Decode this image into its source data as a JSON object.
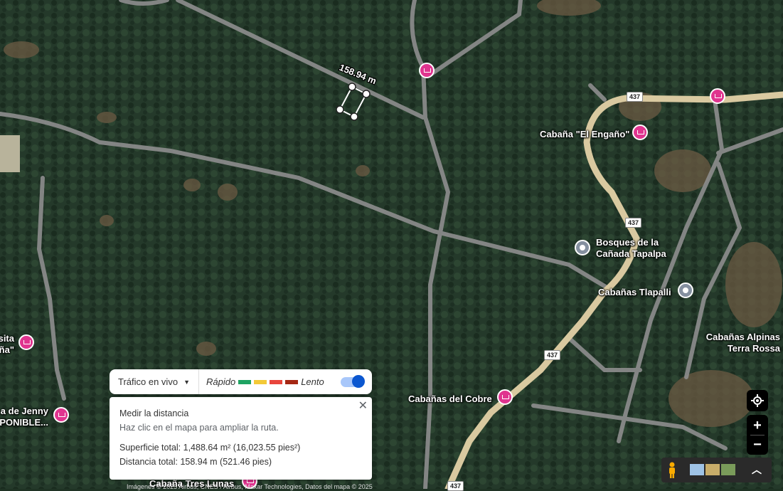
{
  "map": {
    "measure_label": "158.94 m",
    "route_shields": [
      "437",
      "437",
      "437",
      "437"
    ],
    "places": [
      {
        "name": "Cabaña \"El Engaño\"",
        "pin": "hotel-pin-icon"
      },
      {
        "name": "Bosques de la\nCañada Tapalpa",
        "pin": "place-pin-icon"
      },
      {
        "name": "Cabañas Tlapalli",
        "pin": "place-pin-icon"
      },
      {
        "name": "Cabañas Alpinas\nTerra Rossa",
        "pin": null
      },
      {
        "name": "Cabañas del Cobre",
        "pin": "hotel-pin-icon"
      },
      {
        "name": "sita\nña\"",
        "pin": "hotel-pin-icon"
      },
      {
        "name": "a de Jenny\nPONIBLE...",
        "pin": "hotel-pin-icon"
      },
      {
        "name": "Cabaña Tres Lunas",
        "pin": "hotel-pin-icon"
      }
    ]
  },
  "traffic": {
    "selector_label": "Tráfico en vivo",
    "fast_label": "Rápido",
    "slow_label": "Lento",
    "colors": [
      "#1ea362",
      "#f3c937",
      "#e8453c",
      "#a52714"
    ],
    "enabled": true
  },
  "measure_panel": {
    "title": "Medir la distancia",
    "hint": "Haz clic en el mapa para ampliar la ruta.",
    "area": "Superficie total: 1,488.64 m² (16,023.55 pies²)",
    "distance": "Distancia total: 158.94 m (521.46 pies)",
    "close_icon": "close-icon"
  },
  "controls": {
    "locate_icon": "my-location-icon",
    "zoom_in": "+",
    "zoom_out": "−",
    "pegman_icon": "pegman-icon",
    "layers_icon": "layers-icon",
    "expand_icon": "chevron-up-icon"
  },
  "footer": "Imágenes © 2025 Airbus, CNES / Airbus, Maxar Technologies, Datos del mapa © 2025"
}
